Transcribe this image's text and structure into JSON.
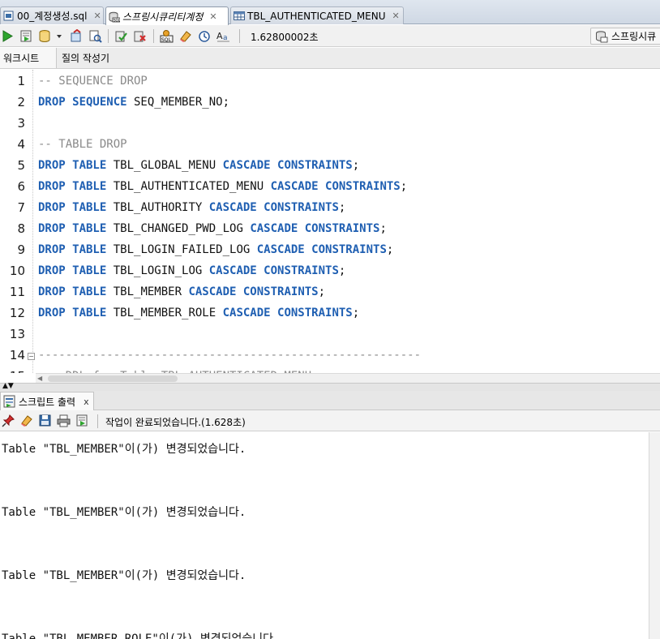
{
  "doc_tabs": [
    {
      "label": "00_계정생성.sql",
      "active": false,
      "italic": false,
      "icon": "sql-file-icon"
    },
    {
      "label": "스프링시큐리티계정",
      "active": true,
      "italic": true,
      "icon": "db-connection-icon"
    },
    {
      "label": "TBL_AUTHENTICATED_MENU",
      "active": false,
      "italic": false,
      "icon": "table-icon"
    }
  ],
  "toolbar": {
    "elapsed_time": "1.62800002초",
    "connection": "스프링시큐"
  },
  "sub_tabs": {
    "worksheet": "워크시트",
    "query_builder": "질의 작성기"
  },
  "editor": {
    "lines": [
      {
        "no": "1",
        "segments": [
          {
            "t": "-- SEQUENCE DROP",
            "c": "cm"
          }
        ]
      },
      {
        "no": "2",
        "segments": [
          {
            "t": "DROP SEQUENCE",
            "c": "kw"
          },
          {
            "t": " SEQ_MEMBER_NO;",
            "c": ""
          }
        ]
      },
      {
        "no": "3",
        "segments": []
      },
      {
        "no": "4",
        "segments": [
          {
            "t": "-- TABLE DROP",
            "c": "cm"
          }
        ]
      },
      {
        "no": "5",
        "segments": [
          {
            "t": "DROP TABLE",
            "c": "kw"
          },
          {
            "t": " TBL_GLOBAL_MENU ",
            "c": ""
          },
          {
            "t": "CASCADE CONSTRAINTS",
            "c": "kw"
          },
          {
            "t": ";",
            "c": ""
          }
        ]
      },
      {
        "no": "6",
        "segments": [
          {
            "t": "DROP TABLE",
            "c": "kw"
          },
          {
            "t": " TBL_AUTHENTICATED_MENU ",
            "c": ""
          },
          {
            "t": "CASCADE CONSTRAINTS",
            "c": "kw"
          },
          {
            "t": ";",
            "c": ""
          }
        ]
      },
      {
        "no": "7",
        "segments": [
          {
            "t": "DROP TABLE",
            "c": "kw"
          },
          {
            "t": " TBL_AUTHORITY ",
            "c": ""
          },
          {
            "t": "CASCADE CONSTRAINTS",
            "c": "kw"
          },
          {
            "t": ";",
            "c": ""
          }
        ]
      },
      {
        "no": "8",
        "segments": [
          {
            "t": "DROP TABLE",
            "c": "kw"
          },
          {
            "t": " TBL_CHANGED_PWD_LOG ",
            "c": ""
          },
          {
            "t": "CASCADE CONSTRAINTS",
            "c": "kw"
          },
          {
            "t": ";",
            "c": ""
          }
        ]
      },
      {
        "no": "9",
        "segments": [
          {
            "t": "DROP TABLE",
            "c": "kw"
          },
          {
            "t": " TBL_LOGIN_FAILED_LOG ",
            "c": ""
          },
          {
            "t": "CASCADE CONSTRAINTS",
            "c": "kw"
          },
          {
            "t": ";",
            "c": ""
          }
        ]
      },
      {
        "no": "10",
        "segments": [
          {
            "t": "DROP TABLE",
            "c": "kw"
          },
          {
            "t": " TBL_LOGIN_LOG ",
            "c": ""
          },
          {
            "t": "CASCADE CONSTRAINTS",
            "c": "kw"
          },
          {
            "t": ";",
            "c": ""
          }
        ]
      },
      {
        "no": "11",
        "segments": [
          {
            "t": "DROP TABLE",
            "c": "kw"
          },
          {
            "t": " TBL_MEMBER ",
            "c": ""
          },
          {
            "t": "CASCADE CONSTRAINTS",
            "c": "kw"
          },
          {
            "t": ";",
            "c": ""
          }
        ]
      },
      {
        "no": "12",
        "segments": [
          {
            "t": "DROP TABLE",
            "c": "kw"
          },
          {
            "t": " TBL_MEMBER_ROLE ",
            "c": ""
          },
          {
            "t": "CASCADE CONSTRAINTS",
            "c": "kw"
          },
          {
            "t": ";",
            "c": ""
          }
        ]
      },
      {
        "no": "13",
        "segments": []
      },
      {
        "no": "14",
        "segments": [
          {
            "t": "--------------------------------------------------------",
            "c": "cm"
          }
        ],
        "fold": true
      },
      {
        "no": "15",
        "segments": [
          {
            "t": "--  DDL for Table TBL_AUTHENTICATED_MENU",
            "c": "cm"
          }
        ]
      }
    ]
  },
  "output_panel": {
    "tab_label": "스크립트 출력",
    "close_label": "x",
    "status": "작업이 완료되었습니다.(1.628초)",
    "lines": [
      "Table \"TBL_MEMBER\"이(가) 변경되었습니다.",
      "Table \"TBL_MEMBER\"이(가) 변경되었습니다.",
      "Table \"TBL_MEMBER\"이(가) 변경되었습니다.",
      "Table \"TBL_MEMBER_ROLE\"이(가) 변경되었습니다."
    ]
  },
  "colors": {
    "keyword": "#1f5fb2",
    "comment": "#8a8a8a"
  }
}
